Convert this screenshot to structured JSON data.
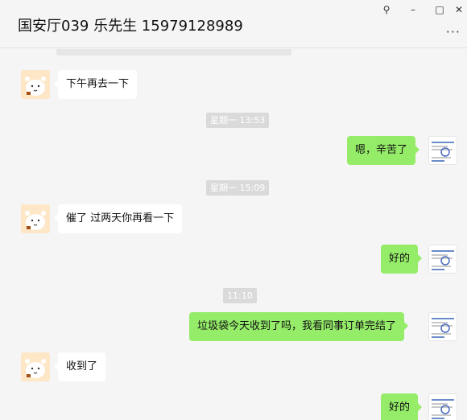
{
  "window": {
    "title": "国安厅039 乐先生 15979128989",
    "pin_icon": "⚲",
    "minimize_icon": "–",
    "maximize_icon": "□",
    "close_icon": "✕",
    "more_icon": "···"
  },
  "timestamps": [
    "星期一 13:53",
    "星期一 15:09",
    "11:10"
  ],
  "messages": [
    {
      "side": "left",
      "text": "下午再去一下"
    },
    {
      "side": "right",
      "text": "嗯，辛苦了"
    },
    {
      "side": "left",
      "text": "催了 过两天你再看一下"
    },
    {
      "side": "right",
      "text": "好的"
    },
    {
      "side": "right",
      "text": "垃圾袋今天收到了吗，我看同事订单完结了"
    },
    {
      "side": "left",
      "text": "收到了"
    },
    {
      "side": "right",
      "text": "好的"
    }
  ],
  "colors": {
    "sent_bubble": "#95ec69",
    "received_bubble": "#ffffff",
    "background": "#f5f5f5",
    "timestamp_bg": "#dadada"
  }
}
